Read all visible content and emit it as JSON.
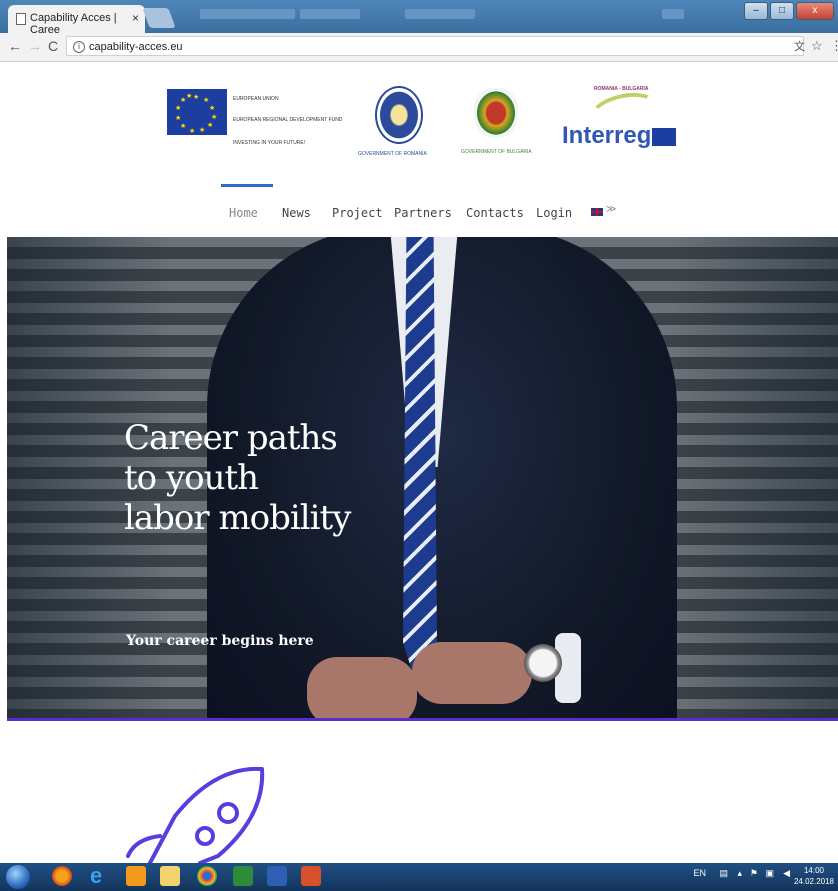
{
  "browser": {
    "tab_title": "Capability Acces | Caree",
    "tab_close": "×",
    "url": "capability-acces.eu",
    "info_icon": "i",
    "back_icon": "←",
    "forward_icon": "→",
    "reload_icon": "C",
    "translate_icon": "⽂",
    "star_icon": "☆",
    "menu_icon": "⋮",
    "win_min": "‒",
    "win_max": "□",
    "win_close": "x"
  },
  "logos": {
    "eu_lines": [
      "EUROPEAN UNION",
      "EUROPEAN REGIONAL DEVELOPMENT FUND",
      "INVESTING IN YOUR FUTURE!"
    ],
    "romania_caption": "GOVERNMENT OF ROMANIA",
    "bulgaria_caption": "GOVERNMENT OF BULGARIA",
    "programme": "ROMANIA - BULGARIA",
    "interreg": "Interreg"
  },
  "nav": {
    "items": [
      "Home",
      "News",
      "Project",
      "Partners",
      "Contacts",
      "Login"
    ],
    "active": "Home",
    "language_chevron": "≫"
  },
  "hero": {
    "heading_lines": [
      "Career paths",
      "to youth",
      "labor mobility"
    ],
    "subheading": "Your career begins here"
  },
  "taskbar": {
    "tray_lang": "EN",
    "time": "14:00",
    "date": "24.02.2018"
  },
  "colors": {
    "accent": "#2e6ad1",
    "hero_border": "#5b2ad1",
    "rocket": "#5b3ce0",
    "interreg": "#3057b6"
  }
}
